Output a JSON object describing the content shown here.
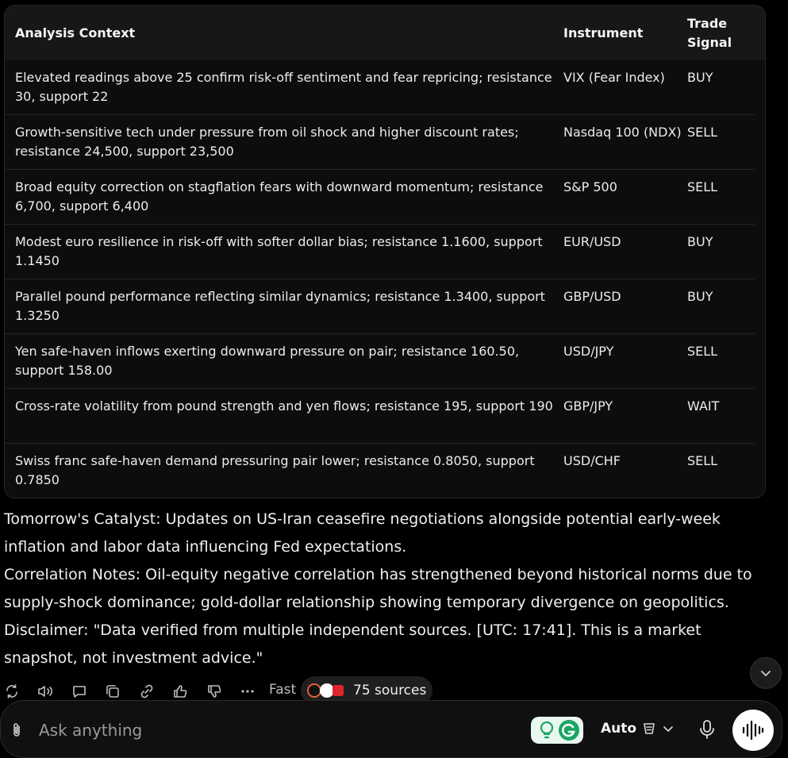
{
  "table": {
    "headers": {
      "context": "Analysis Context",
      "instrument": "Instrument",
      "signal_line1": "Trade",
      "signal_line2": "Signal"
    },
    "rows": [
      {
        "context": "Elevated readings above 25 confirm risk-off sentiment and fear repricing; resistance 30, support 22",
        "instrument": "VIX (Fear Index)",
        "signal": "BUY"
      },
      {
        "context": "Growth-sensitive tech under pressure from oil shock and higher discount rates; resistance 24,500, support 23,500",
        "instrument": "Nasdaq 100 (NDX)",
        "signal": "SELL"
      },
      {
        "context": "Broad equity correction on stagflation fears with downward momentum; resistance 6,700, support 6,400",
        "instrument": "S&P 500",
        "signal": "SELL"
      },
      {
        "context": "Modest euro resilience in risk-off with softer dollar bias; resistance 1.1600, support 1.1450",
        "instrument": "EUR/USD",
        "signal": "BUY"
      },
      {
        "context": "Parallel pound performance reflecting similar dynamics; resistance 1.3400, support 1.3250",
        "instrument": "GBP/USD",
        "signal": "BUY"
      },
      {
        "context": "Yen safe-haven inflows exerting downward pressure on pair; resistance 160.50, support 158.00",
        "instrument": "USD/JPY",
        "signal": "SELL"
      },
      {
        "context": "Cross-rate volatility from pound strength and yen flows; resistance 195, support 190",
        "instrument": "GBP/JPY",
        "signal": "WAIT"
      },
      {
        "context": "Swiss franc safe-haven demand pressuring pair lower; resistance 0.8050, support 0.7850",
        "instrument": "USD/CHF",
        "signal": "SELL"
      }
    ]
  },
  "prose": {
    "catalyst": "Tomorrow's Catalyst: Updates on US-Iran ceasefire negotiations alongside potential early-week inflation and labor data influencing Fed expectations.",
    "correlation": "Correlation Notes: Oil-equity negative correlation has strengthened beyond historical norms due to supply-shock dominance; gold-dollar relationship showing temporary divergence on geopolitics.",
    "disclaimer": "Disclaimer: \"Data verified from multiple independent sources. [UTC: 17:41]. This is a market snapshot, not investment advice.\""
  },
  "actions": {
    "icons": [
      "rewrite-icon",
      "speaker-icon",
      "comment-icon",
      "copy-icon",
      "link-icon",
      "thumbs-up-icon",
      "thumbs-down-icon",
      "more-icon"
    ],
    "fast_label": "Fast",
    "sources_label": "75 sources"
  },
  "input": {
    "placeholder": "Ask anything",
    "mode_label": "Auto"
  },
  "colors": {
    "background": "#000000",
    "table_header": "#171717",
    "accent_green": "#1aa564",
    "source_red": "#e0242b"
  }
}
